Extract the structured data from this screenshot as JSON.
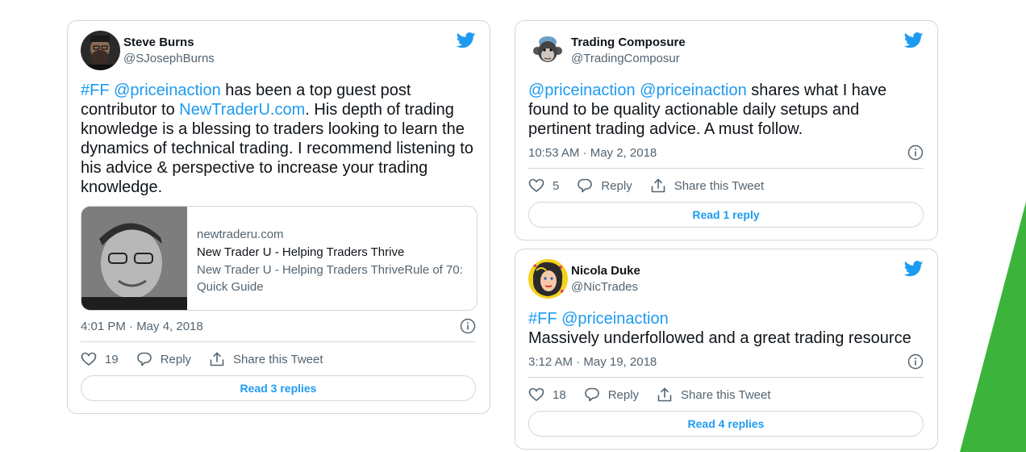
{
  "colors": {
    "accent": "#1d9bf0",
    "green": "#3cb43c",
    "muted": "#536471",
    "border": "#cfd9de"
  },
  "tweets": [
    {
      "author": {
        "name": "Steve Burns",
        "handle": "@SJosephBurns",
        "avatar_icon": "bearded-man-avatar"
      },
      "text": {
        "hashtag": "#FF",
        "mention": "@priceinaction",
        "part1": " has been a top guest post contributor to ",
        "site_link": "NewTraderU.com",
        "part2": ". His depth of trading knowledge is a blessing to traders looking to learn the dynamics of technical trading. I recommend listening to his advice & perspective to increase your trading knowledge."
      },
      "link_card": {
        "domain": "newtraderu.com",
        "title": "New Trader U - Helping Traders Thrive",
        "description": "New Trader U - Helping Traders ThriveRule of 70: Quick Guide"
      },
      "timestamp": "4:01 PM · May 4, 2018",
      "likes": "19",
      "reply_label": "Reply",
      "share_label": "Share this Tweet",
      "read_replies": "Read 3 replies"
    },
    {
      "author": {
        "name": "Trading Composure",
        "handle": "@TradingComposur",
        "avatar_icon": "monkey-avatar"
      },
      "text": {
        "mention1": "@priceinaction",
        "mention2": "@priceinaction",
        "part1": " shares what I have found to be quality actionable daily setups and pertinent trading advice. A must follow."
      },
      "timestamp": "10:53 AM · May 2, 2018",
      "likes": "5",
      "reply_label": "Reply",
      "share_label": "Share this Tweet",
      "read_replies": "Read 1 reply"
    },
    {
      "author": {
        "name": "Nicola Duke",
        "handle": "@NicTrades",
        "avatar_icon": "pop-art-avatar"
      },
      "text": {
        "hashtag": "#FF",
        "mention": "@priceinaction",
        "line2": "Massively underfollowed and a great trading resource"
      },
      "timestamp": "3:12 AM · May 19, 2018",
      "likes": "18",
      "reply_label": "Reply",
      "share_label": "Share this Tweet",
      "read_replies": "Read 4 replies"
    }
  ]
}
